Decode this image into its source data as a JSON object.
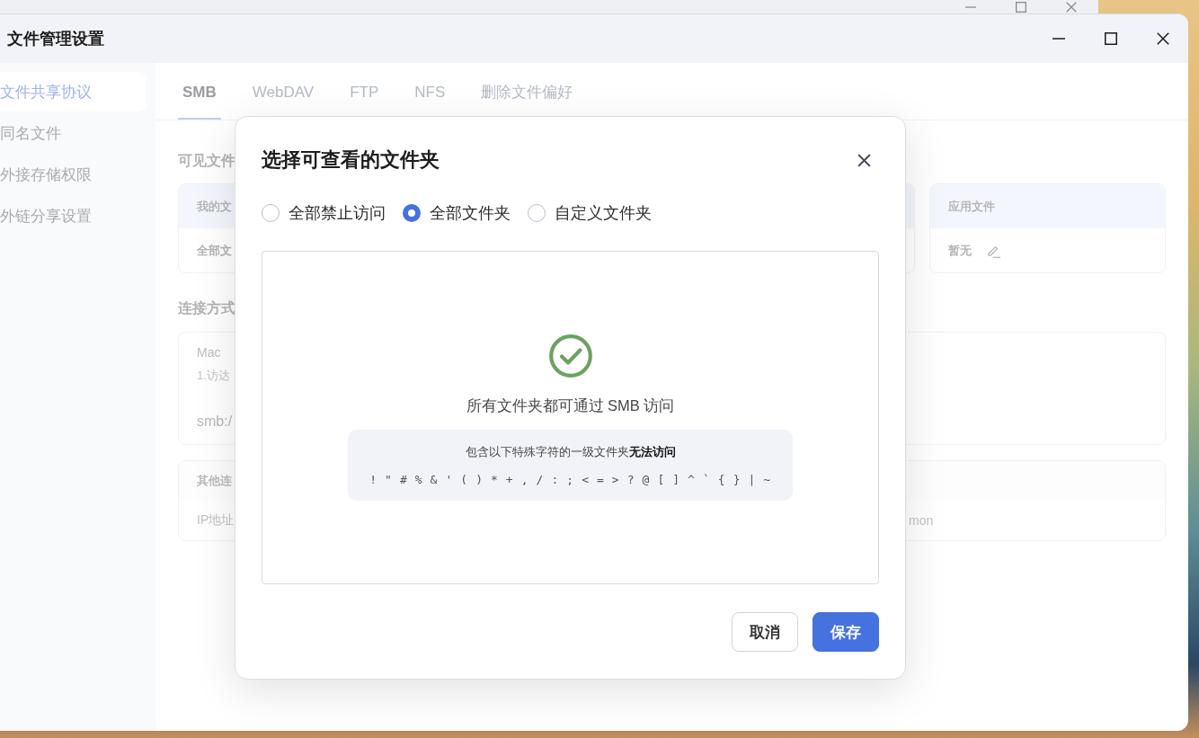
{
  "window": {
    "title": "文件管理设置"
  },
  "sidebar": {
    "items": [
      {
        "label": "文件共享协议",
        "selected": true
      },
      {
        "label": "同名文件",
        "selected": false
      },
      {
        "label": "外接存储权限",
        "selected": false
      },
      {
        "label": "外链分享设置",
        "selected": false
      }
    ]
  },
  "tabs": [
    {
      "label": "SMB",
      "selected": true
    },
    {
      "label": "WebDAV",
      "selected": false
    },
    {
      "label": "FTP",
      "selected": false
    },
    {
      "label": "NFS",
      "selected": false
    },
    {
      "label": "删除文件偏好",
      "selected": false
    }
  ],
  "visible_folders": {
    "heading": "可见文件",
    "cards": [
      {
        "kind": "folder",
        "header": "我的文",
        "value": "全部文",
        "editable": false
      },
      {
        "kind": "hidden"
      },
      {
        "kind": "covered"
      },
      {
        "kind": "folder",
        "header": "应用文件",
        "value": "暂无",
        "editable": true
      }
    ]
  },
  "connection": {
    "heading": "连接方式",
    "cards": [
      {
        "kind": "guide",
        "title": "Mac",
        "step": "1.访达",
        "address": "smb:/"
      },
      {
        "kind": "fields",
        "title": "其他连",
        "column_1": "IP地址",
        "column_2": "mon"
      }
    ]
  },
  "dialog": {
    "title": "选择可查看的文件夹",
    "options": [
      {
        "label": "全部禁止访问",
        "selected": false
      },
      {
        "label": "全部文件夹",
        "selected": true
      },
      {
        "label": "自定义文件夹",
        "selected": false
      }
    ],
    "message": "所有文件夹都可通过 SMB 访问",
    "note": "包含以下特殊字符的一级文件夹**无法访问**",
    "characters": "! \" # % & ' ( ) * + , / : ; < = > ? @ [ ] ^ ` { } | ~",
    "buttons": [
      {
        "label": "取消",
        "kind": "secondary"
      },
      {
        "label": "保存",
        "kind": "primary"
      }
    ]
  }
}
